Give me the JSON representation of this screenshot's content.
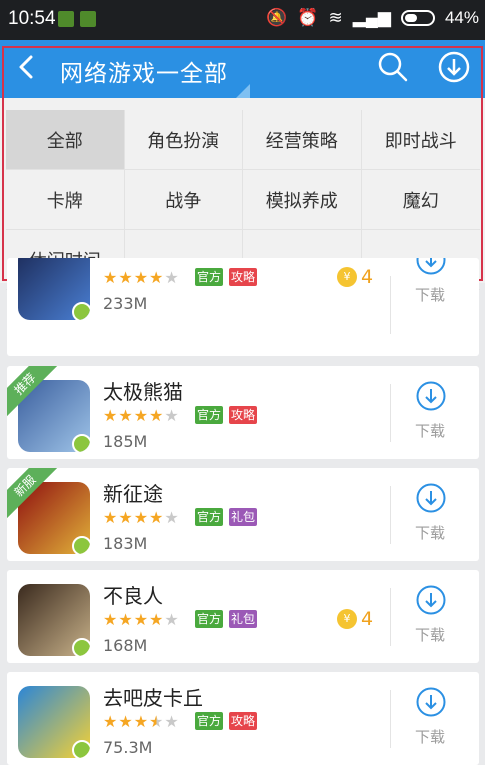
{
  "status_bar": {
    "time": "10:54",
    "battery": "44%"
  },
  "header": {
    "title": "网络游戏一全部"
  },
  "categories": [
    "全部",
    "角色扮演",
    "经营策略",
    "即时战斗",
    "卡牌",
    "战争",
    "模拟养成",
    "魔幻",
    "休闲时间"
  ],
  "selected_category": "全部",
  "apps": [
    {
      "name": "",
      "rating": 4,
      "tags": [
        "官方",
        "攻略"
      ],
      "size": "233M",
      "coins": "4",
      "ribbon": "",
      "download_label": "下载",
      "icon_colors": [
        "#1c2b59",
        "#4a7fd3"
      ]
    },
    {
      "name": "太极熊猫",
      "rating": 4,
      "tags": [
        "官方",
        "攻略"
      ],
      "size": "185M",
      "coins": "",
      "ribbon": "推荐",
      "download_label": "下载",
      "icon_colors": [
        "#3b5f9e",
        "#9fc4e8"
      ]
    },
    {
      "name": "新征途",
      "rating": 4,
      "tags": [
        "官方",
        "礼包"
      ],
      "size": "183M",
      "coins": "",
      "ribbon": "新服",
      "download_label": "下载",
      "icon_colors": [
        "#8f1010",
        "#e2b33a"
      ]
    },
    {
      "name": "不良人",
      "rating": 4,
      "tags": [
        "官方",
        "礼包"
      ],
      "size": "168M",
      "coins": "4",
      "ribbon": "",
      "download_label": "下载",
      "icon_colors": [
        "#3a2a1e",
        "#c9b28a"
      ]
    },
    {
      "name": "去吧皮卡丘",
      "rating": 3.5,
      "tags": [
        "官方",
        "攻略"
      ],
      "size": "75.3M",
      "coins": "",
      "ribbon": "",
      "download_label": "下载",
      "icon_colors": [
        "#2c86d6",
        "#f6d234"
      ]
    }
  ],
  "colors": {
    "header": "#2b90e3",
    "accent": "#2b90e3",
    "star": "#f5a623",
    "tag_official": "#4aa93e",
    "tag_strategy": "#e6454b",
    "tag_gift": "#9b59b6"
  },
  "icons": {
    "back": "chevron-left-icon",
    "search": "search-icon",
    "download": "download-circle-icon"
  }
}
